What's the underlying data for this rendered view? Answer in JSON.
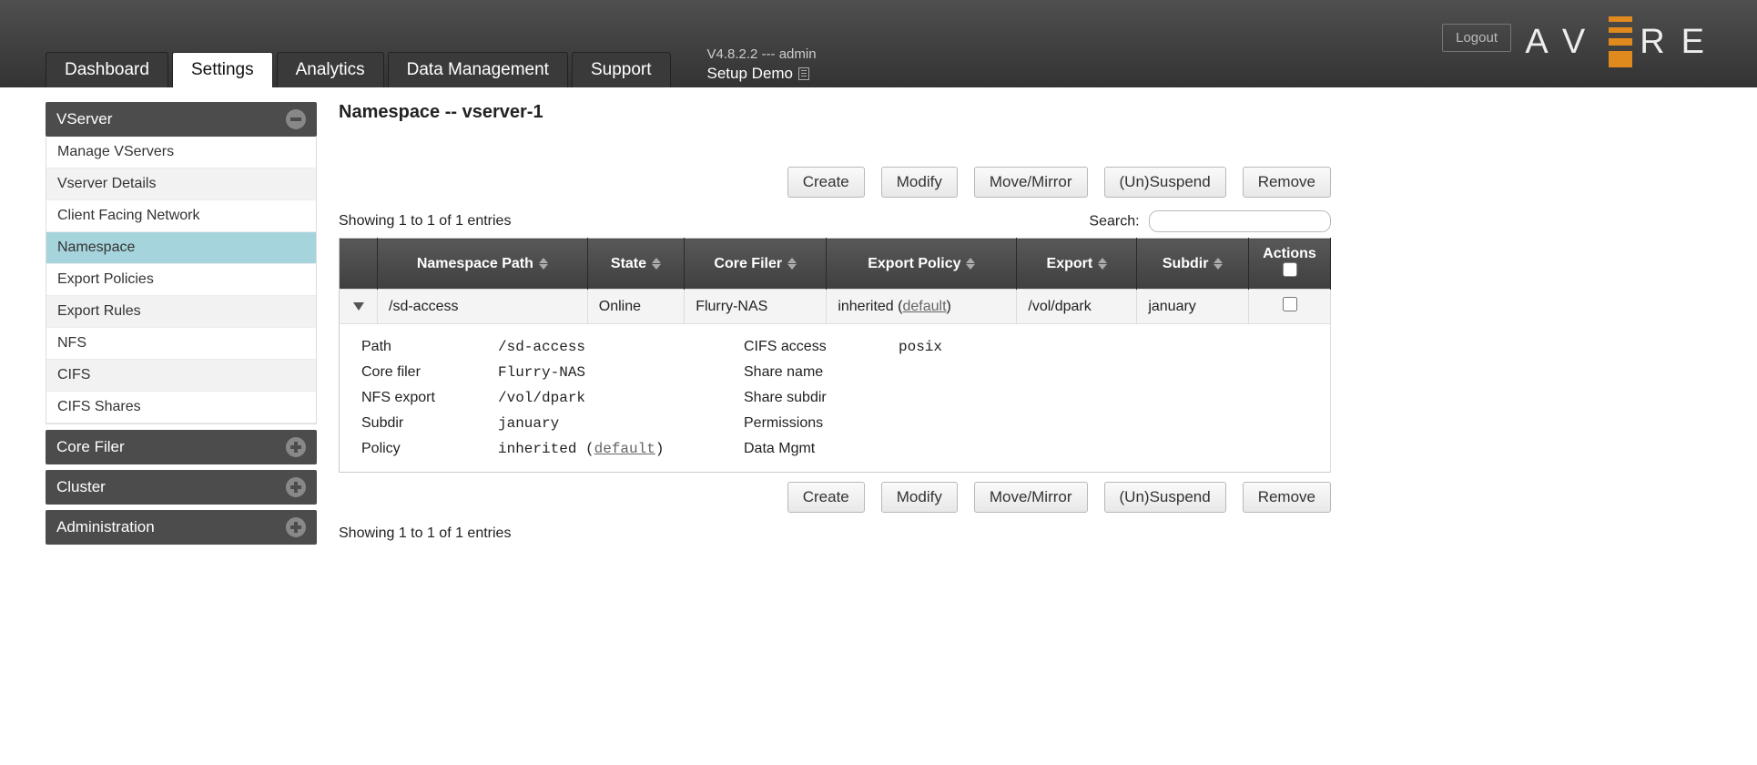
{
  "header": {
    "logout_label": "Logout",
    "version_line": "V4.8.2.2 --- admin",
    "setup_line": "Setup Demo",
    "brand_letters_left": "AV",
    "brand_letters_right": "RE",
    "tabs": [
      {
        "label": "Dashboard"
      },
      {
        "label": "Settings"
      },
      {
        "label": "Analytics"
      },
      {
        "label": "Data Management"
      },
      {
        "label": "Support"
      }
    ],
    "active_tab_index": 1
  },
  "sidebar": {
    "groups": [
      {
        "label": "VServer",
        "expanded": true,
        "items": [
          {
            "label": "Manage VServers"
          },
          {
            "label": "Vserver Details"
          },
          {
            "label": "Client Facing Network"
          },
          {
            "label": "Namespace",
            "active": true
          },
          {
            "label": "Export Policies"
          },
          {
            "label": "Export Rules"
          },
          {
            "label": "NFS"
          },
          {
            "label": "CIFS"
          },
          {
            "label": "CIFS Shares"
          }
        ]
      },
      {
        "label": "Core Filer",
        "expanded": false
      },
      {
        "label": "Cluster",
        "expanded": false
      },
      {
        "label": "Administration",
        "expanded": false
      }
    ]
  },
  "main": {
    "title": "Namespace -- vserver-1",
    "buttons": {
      "create": "Create",
      "modify": "Modify",
      "move_mirror": "Move/Mirror",
      "suspend": "(Un)Suspend",
      "remove": "Remove"
    },
    "entries_text": "Showing 1 to 1 of 1 entries",
    "search_label": "Search:",
    "columns": {
      "namespace_path": "Namespace Path",
      "state": "State",
      "core_filer": "Core Filer",
      "export_policy": "Export Policy",
      "export": "Export",
      "subdir": "Subdir",
      "actions": "Actions"
    },
    "row": {
      "namespace_path": "/sd-access",
      "state": "Online",
      "core_filer": "Flurry-NAS",
      "export_policy_prefix": "inherited (",
      "export_policy_link": "default",
      "export_policy_suffix": ")",
      "export": "/vol/dpark",
      "subdir": "january"
    },
    "details": {
      "labels": {
        "path": "Path",
        "core_filer": "Core filer",
        "nfs_export": "NFS export",
        "subdir": "Subdir",
        "policy": "Policy",
        "cifs_access": "CIFS access",
        "share_name": "Share name",
        "share_subdir": "Share subdir",
        "permissions": "Permissions",
        "data_mgmt": "Data Mgmt"
      },
      "values": {
        "path": "/sd-access",
        "core_filer": "Flurry-NAS",
        "nfs_export": "/vol/dpark",
        "subdir": "january",
        "policy_prefix": "inherited (",
        "policy_link": "default",
        "policy_suffix": ")",
        "cifs_access": "posix",
        "share_name": "",
        "share_subdir": "",
        "permissions": "",
        "data_mgmt": ""
      }
    }
  }
}
